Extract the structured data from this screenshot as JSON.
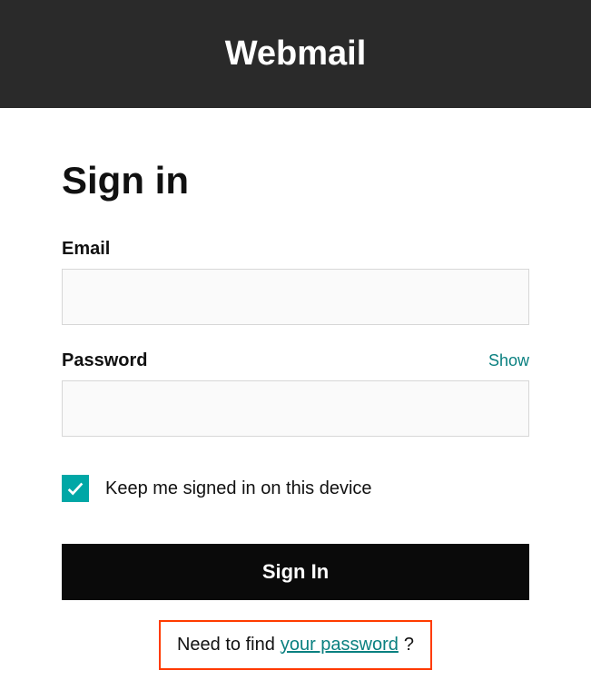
{
  "header": {
    "title": "Webmail"
  },
  "form": {
    "heading": "Sign in",
    "email_label": "Email",
    "email_value": "",
    "password_label": "Password",
    "password_value": "",
    "show_toggle": "Show",
    "keep_signed_label": "Keep me signed in on this device",
    "keep_signed_checked": true,
    "submit_label": "Sign In"
  },
  "help": {
    "prefix": "Need to find ",
    "link_text": "your password",
    "suffix": "?"
  }
}
